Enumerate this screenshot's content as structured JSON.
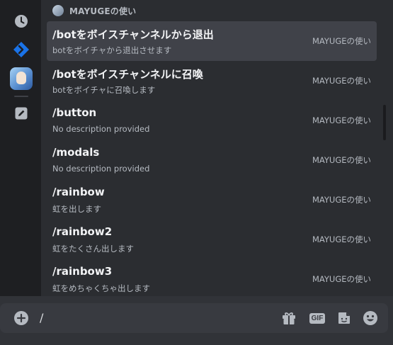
{
  "rail": {
    "items": [
      {
        "icon": "clock-icon"
      },
      {
        "icon": "app-directory-icon"
      },
      {
        "icon": "bot-avatar"
      },
      {
        "icon": "pencil-icon"
      }
    ]
  },
  "header": {
    "title": "MAYUGEの使い"
  },
  "commands": [
    {
      "name": "/botをボイスチャンネルから退出",
      "description": "botをボイチャから退出させます",
      "source": "MAYUGEの使い"
    },
    {
      "name": "/botをボイスチャンネルに召喚",
      "description": "botをボイチャに召喚します",
      "source": "MAYUGEの使い"
    },
    {
      "name": "/button",
      "description": "No description provided",
      "source": "MAYUGEの使い"
    },
    {
      "name": "/modals",
      "description": "No description provided",
      "source": "MAYUGEの使い"
    },
    {
      "name": "/rainbow",
      "description": "虹を出します",
      "source": "MAYUGEの使い"
    },
    {
      "name": "/rainbow2",
      "description": "虹をたくさん出します",
      "source": "MAYUGEの使い"
    },
    {
      "name": "/rainbow3",
      "description": "虹をめちゃくちゃ出します",
      "source": "MAYUGEの使い"
    }
  ],
  "composer": {
    "value": "/",
    "gif_label": "GIF"
  },
  "colors": {
    "background": "#313338",
    "popup": "#2b2d31",
    "rail": "#1e1f22",
    "selected_row": "#404249",
    "accent_blue": "#1a73e8"
  }
}
